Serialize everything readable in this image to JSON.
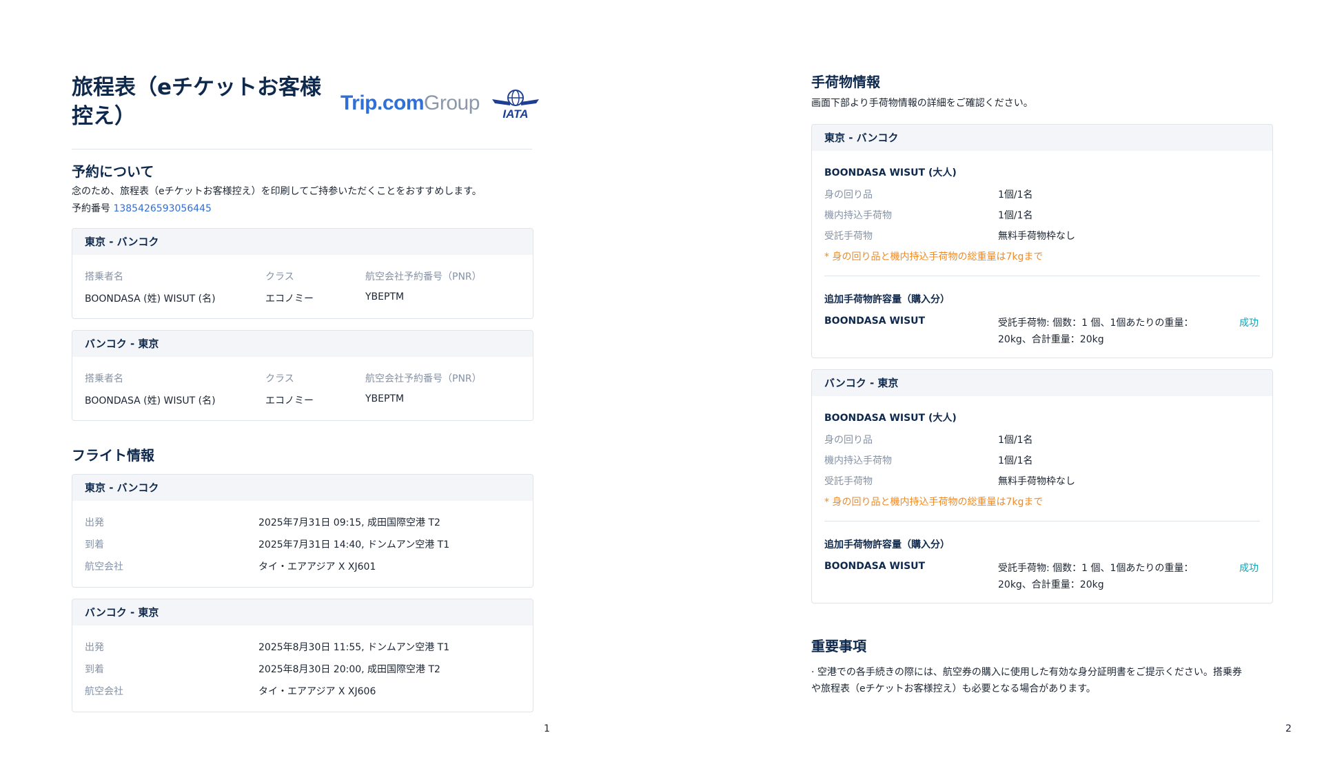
{
  "page1": {
    "title": "旅程表（eチケットお客様控え）",
    "brand": {
      "trip_bold": "Trip.com",
      "trip_light": "Group",
      "iata": "IATA"
    },
    "booking": {
      "heading": "予約について",
      "note": "念のため、旅程表（eチケットお客様控え）を印刷してご持参いただくことをおすすめします。",
      "number_label": "予約番号",
      "number_value": "1385426593056445"
    },
    "passenger_cards": [
      {
        "route": "東京 - バンコク",
        "col_name": "搭乗者名",
        "col_class": "クラス",
        "col_pnr": "航空会社予約番号（PNR）",
        "name": "BOONDASA (姓) WISUT (名)",
        "class": "エコノミー",
        "pnr": "YBEPTM"
      },
      {
        "route": "バンコク - 東京",
        "col_name": "搭乗者名",
        "col_class": "クラス",
        "col_pnr": "航空会社予約番号（PNR）",
        "name": "BOONDASA (姓) WISUT (名)",
        "class": "エコノミー",
        "pnr": "YBEPTM"
      }
    ],
    "flight_heading": "フライト情報",
    "flights": [
      {
        "route": "東京 - バンコク",
        "dep_label": "出発",
        "dep_value": "2025年7月31日 09:15, 成田国際空港 T2",
        "arr_label": "到着",
        "arr_value": "2025年7月31日 14:40, ドンムアン空港 T1",
        "airline_label": "航空会社",
        "airline_value": "タイ・エアアジア X XJ601"
      },
      {
        "route": "バンコク - 東京",
        "dep_label": "出発",
        "dep_value": "2025年8月30日 11:55, ドンムアン空港 T1",
        "arr_label": "到着",
        "arr_value": "2025年8月30日 20:00, 成田国際空港 T2",
        "airline_label": "航空会社",
        "airline_value": "タイ・エアアジア X XJ606"
      }
    ],
    "page_number": "1"
  },
  "page2": {
    "baggage_heading": "手荷物情報",
    "baggage_note": "画面下部より手荷物情報の詳細をご確認ください。",
    "baggage_cards": [
      {
        "route": "東京 - バンコク",
        "passenger": "BOONDASA WISUT (大人)",
        "personal_label": "身の回り品",
        "personal_value": "1個/1名",
        "carry_label": "機内持込手荷物",
        "carry_value": "1個/1名",
        "checked_label": "受託手荷物",
        "checked_value": "無料手荷物枠なし",
        "weight_note": "* 身の回り品と機内持込手荷物の総重量は7kgまで",
        "extra_heading": "追加手荷物許容量（購入分）",
        "extra_name": "BOONDASA WISUT",
        "extra_line1": "受託手荷物: 個数：1 個、1個あたりの重量：",
        "extra_line2": "20kg、合計重量：20kg",
        "extra_status": "成功"
      },
      {
        "route": "バンコク - 東京",
        "passenger": "BOONDASA WISUT (大人)",
        "personal_label": "身の回り品",
        "personal_value": "1個/1名",
        "carry_label": "機内持込手荷物",
        "carry_value": "1個/1名",
        "checked_label": "受託手荷物",
        "checked_value": "無料手荷物枠なし",
        "weight_note": "* 身の回り品と機内持込手荷物の総重量は7kgまで",
        "extra_heading": "追加手荷物許容量（購入分）",
        "extra_name": "BOONDASA WISUT",
        "extra_line1": "受託手荷物: 個数：1 個、1個あたりの重量：",
        "extra_line2": "20kg、合計重量：20kg",
        "extra_status": "成功"
      }
    ],
    "important_heading": "重要事項",
    "important_line1": "· 空港での各手続きの際には、航空券の購入に使用した有効な身分証明書をご提示ください。搭乗券",
    "important_line2": "や旅程表（eチケットお客様控え）も必要となる場合があります。",
    "page_number": "2"
  }
}
